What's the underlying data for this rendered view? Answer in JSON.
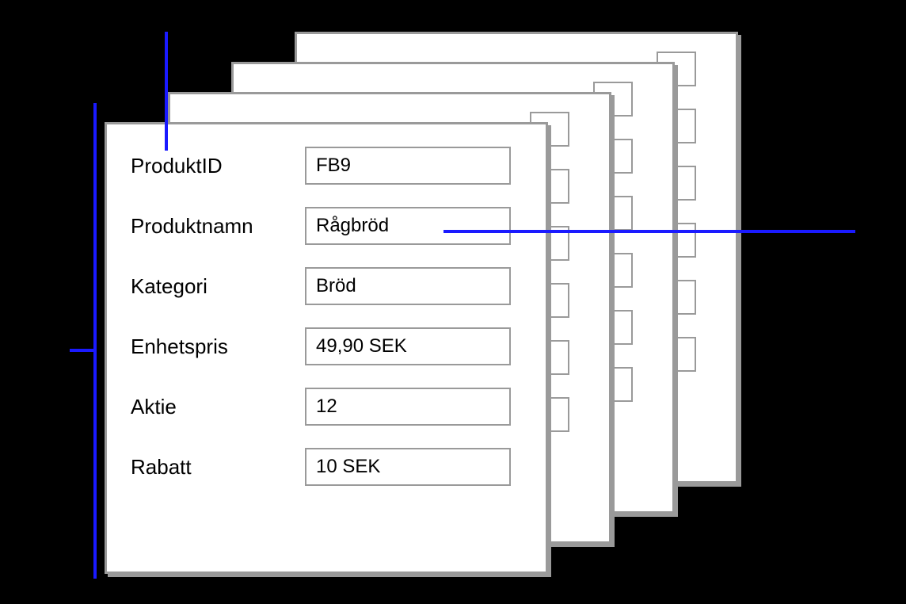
{
  "card": {
    "rows": [
      {
        "label": "ProduktID",
        "value": "FB9"
      },
      {
        "label": "Produktnamn",
        "value": "Rågbröd"
      },
      {
        "label": "Kategori",
        "value": "Bröd"
      },
      {
        "label": "Enhetspris",
        "value": "49,90 SEK"
      },
      {
        "label": "Aktie",
        "value": "12"
      },
      {
        "label": "Rabatt",
        "value": "10 SEK"
      }
    ]
  }
}
